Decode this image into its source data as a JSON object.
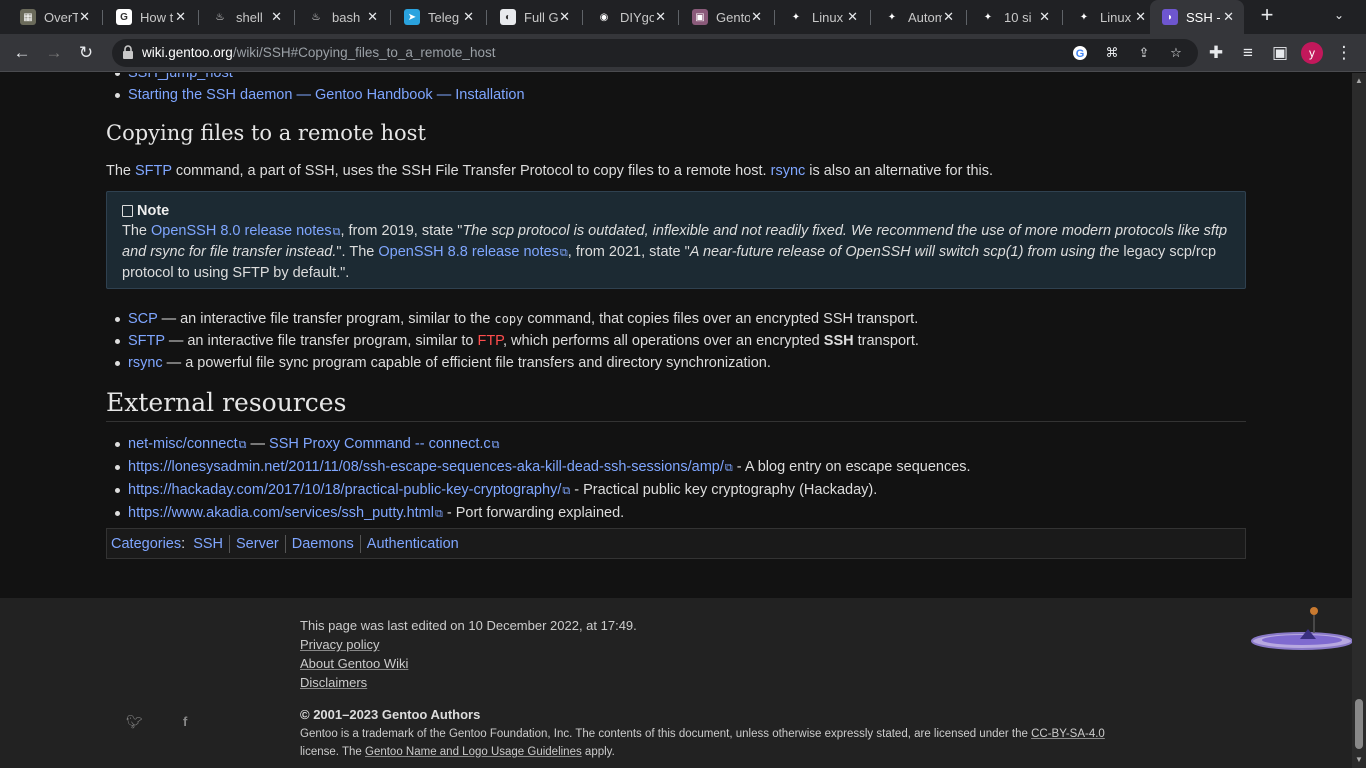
{
  "browser": {
    "tabs": [
      {
        "title": "OverT",
        "fav_color": "#6a6a5a",
        "fav_char": "▦"
      },
      {
        "title": "How t",
        "fav_color": "#ffffff",
        "fav_char": "G"
      },
      {
        "title": "shell",
        "fav_color": "#202124",
        "fav_char": "♨"
      },
      {
        "title": "bash",
        "fav_color": "#202124",
        "fav_char": "♨"
      },
      {
        "title": "Teleg",
        "fav_color": "#2aa3df",
        "fav_char": "➤"
      },
      {
        "title": "Full G",
        "fav_color": "#e8eaed",
        "fav_char": "◐"
      },
      {
        "title": "DIYgo",
        "fav_color": "#202124",
        "fav_char": "◉"
      },
      {
        "title": "Gento",
        "fav_color": "#8a5a7a",
        "fav_char": "▣"
      },
      {
        "title": "Linux",
        "fav_color": "#202124",
        "fav_char": "✦"
      },
      {
        "title": "Autom",
        "fav_color": "#202124",
        "fav_char": "✦"
      },
      {
        "title": "10 si",
        "fav_color": "#202124",
        "fav_char": "✦"
      },
      {
        "title": "Linux",
        "fav_color": "#202124",
        "fav_char": "✦"
      },
      {
        "title": "SSH -",
        "fav_color": "#6e56cf",
        "fav_char": "◗"
      }
    ],
    "url_domain": "wiki.gentoo.org",
    "url_path": "/wiki/SSH#Copying_files_to_a_remote_host",
    "profile_initial": "y"
  },
  "top_list": [
    {
      "text": "SSH_jump_host"
    },
    {
      "text": "Starting the SSH daemon — Gentoo Handbook — Installation"
    }
  ],
  "copying": {
    "heading": "Copying files to a remote host",
    "intro_pre": "The ",
    "intro_link1": "SFTP",
    "intro_mid": " command, a part of SSH, uses the SSH File Transfer Protocol to copy files to a remote host. ",
    "intro_link2": "rsync",
    "intro_post": " is also an alternative for this."
  },
  "note": {
    "title": "Note",
    "p1": "The ",
    "link1": "OpenSSH 8.0 release notes",
    "p2": ", from 2019, state \"",
    "quote1": "The scp protocol is outdated, inflexible and not readily fixed. We recommend the use of more modern protocols like sftp and rsync for file transfer instead.",
    "p3": "\". The ",
    "link2": "OpenSSH 8.8 release notes",
    "p4": ", from 2021, state \"",
    "quote2": "A near-future release of OpenSSH will switch scp(1) from using the",
    "p5": " legacy scp/rcp protocol to using SFTP by default.\"."
  },
  "tools": [
    {
      "link": "SCP",
      "pre": " — an interactive file transfer program, similar to the ",
      "code": "copy",
      "post": " command, that copies files over an encrypted SSH transport."
    },
    {
      "link": "SFTP",
      "pre": " — an interactive file transfer program, similar to ",
      "red": "FTP",
      "mid": ", which performs all operations over an encrypted ",
      "bold": "SSH",
      "post": " transport."
    },
    {
      "link": "rsync",
      "pre": " — a powerful file sync program capable of efficient file transfers and directory synchronization."
    }
  ],
  "external": {
    "heading": "External resources",
    "items": [
      {
        "link": "net-misc/connect",
        "mid": " — ",
        "link2": "SSH Proxy Command -- connect.c"
      },
      {
        "link": "https://lonesysadmin.net/2011/11/08/ssh-escape-sequences-aka-kill-dead-ssh-sessions/amp/",
        "desc": " - A blog entry on escape sequences."
      },
      {
        "link": "https://hackaday.com/2017/10/18/practical-public-key-cryptography/",
        "desc": " - Practical public key cryptography (Hackaday)."
      },
      {
        "link": "https://www.akadia.com/services/ssh_putty.html",
        "desc": " - Port forwarding explained."
      }
    ]
  },
  "categories": {
    "label": "Categories",
    "colon": ":",
    "items": [
      "SSH",
      "Server",
      "Daemons",
      "Authentication"
    ]
  },
  "footer": {
    "last_edited": "This page was last edited on 10 December 2022, at 17:49.",
    "links": [
      "Privacy policy",
      "About Gentoo Wiki",
      "Disclaimers"
    ],
    "copyright": "© 2001–2023 Gentoo Authors",
    "trademark_pre": "Gentoo is a trademark of the Gentoo Foundation, Inc. The contents of this document, unless otherwise expressly stated, are licensed under the ",
    "license_link": "CC-BY-SA-4.0",
    "trademark_mid": "license. The ",
    "guidelines_link": "Gentoo Name and Logo Usage Guidelines",
    "trademark_post": " apply."
  }
}
